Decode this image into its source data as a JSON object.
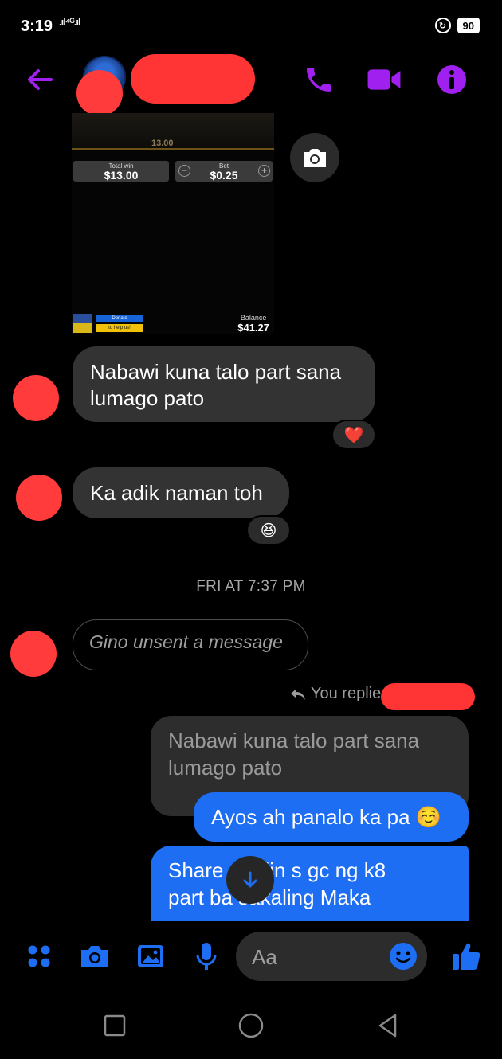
{
  "status_bar": {
    "time": "3:19",
    "signal": ".ıl⁴ᴳ.ıl",
    "battery": "90"
  },
  "header": {
    "contact_name": ""
  },
  "screenshot_image": {
    "multiplier": "13.00",
    "total_win_label": "Total win",
    "total_win_value": "$13.00",
    "bet_label": "Bet",
    "bet_value": "$0.25",
    "minus": "−",
    "plus": "+",
    "donate_label": "Donate",
    "help_label": "to help us!",
    "balance_label": "Balance",
    "balance_value": "$41.27"
  },
  "messages": {
    "incoming_1": "Nabawi kuna talo part sana lumago pato",
    "incoming_1_reaction": "❤️",
    "incoming_2": "Ka adik naman toh",
    "incoming_2_reaction": "😆",
    "timestamp": "FRI AT 7:37 PM",
    "unsent": "Gino unsent a message",
    "reply_label": "You replie",
    "quoted_text": "Nabawi kuna talo part sana lumago pato",
    "outgoing_1": "Ayos ah panalo ka pa ☺️",
    "outgoing_2_line1": "Share   ng din s gc ng k8",
    "outgoing_2_line2": "part ba   sakaling Maka"
  },
  "composer": {
    "placeholder": "Aa"
  },
  "colors": {
    "accent": "#a020f0",
    "messenger_blue": "#1d6ef3",
    "redaction": "#ff3b3b"
  },
  "icons": [
    "back-arrow-icon",
    "phone-icon",
    "video-icon",
    "info-icon",
    "camera-icon",
    "menu-dots-icon",
    "image-icon",
    "mic-icon",
    "emoji-icon",
    "thumbs-up-icon",
    "scroll-down-icon",
    "reply-icon",
    "recent-apps-icon",
    "home-icon",
    "back-icon"
  ]
}
